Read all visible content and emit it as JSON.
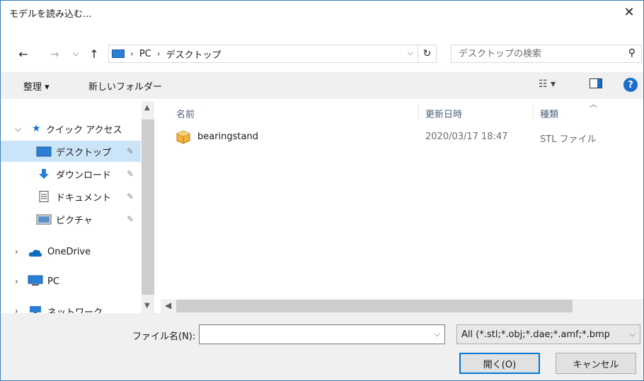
{
  "window": {
    "title": "モデルを読み込む...",
    "close_label": "✕"
  },
  "address": {
    "crumbs": [
      "PC",
      "デスクトップ"
    ]
  },
  "search": {
    "placeholder": "デスクトップの検索"
  },
  "toolbar": {
    "organize_label": "整理 ▾",
    "new_folder_label": "新しいフォルダー",
    "view_icon": "view-options-icon",
    "preview_icon": "preview-pane-icon",
    "help_label": "?"
  },
  "nav": {
    "quick_access": "クイック アクセス",
    "items": [
      {
        "label": "デスクトップ",
        "icon": "desktop-icon",
        "pinned": true
      },
      {
        "label": "ダウンロード",
        "icon": "download-icon",
        "pinned": true
      },
      {
        "label": "ドキュメント",
        "icon": "document-icon",
        "pinned": true
      },
      {
        "label": "ピクチャ",
        "icon": "picture-icon",
        "pinned": true
      }
    ],
    "onedrive": "OneDrive",
    "pc": "PC",
    "network": "ネットワーク"
  },
  "columns": {
    "name": "名前",
    "date": "更新日時",
    "type": "種類"
  },
  "files": [
    {
      "name": "bearingstand",
      "date": "2020/03/17 18:47",
      "type": "STL ファイル",
      "icon": "3d-object-icon"
    }
  ],
  "bottom": {
    "filename_label": "ファイル名(N):",
    "filename_value": "",
    "filter_value": "All (*.stl;*.obj;*.dae;*.amf;*.bmp",
    "open_label": "開く(O)",
    "cancel_label": "キャンセル"
  },
  "colors": {
    "selection": "#cce4f7",
    "accent": "#0078d7",
    "help": "#1c6fc9",
    "folder_blue": "#2a7fd4"
  }
}
